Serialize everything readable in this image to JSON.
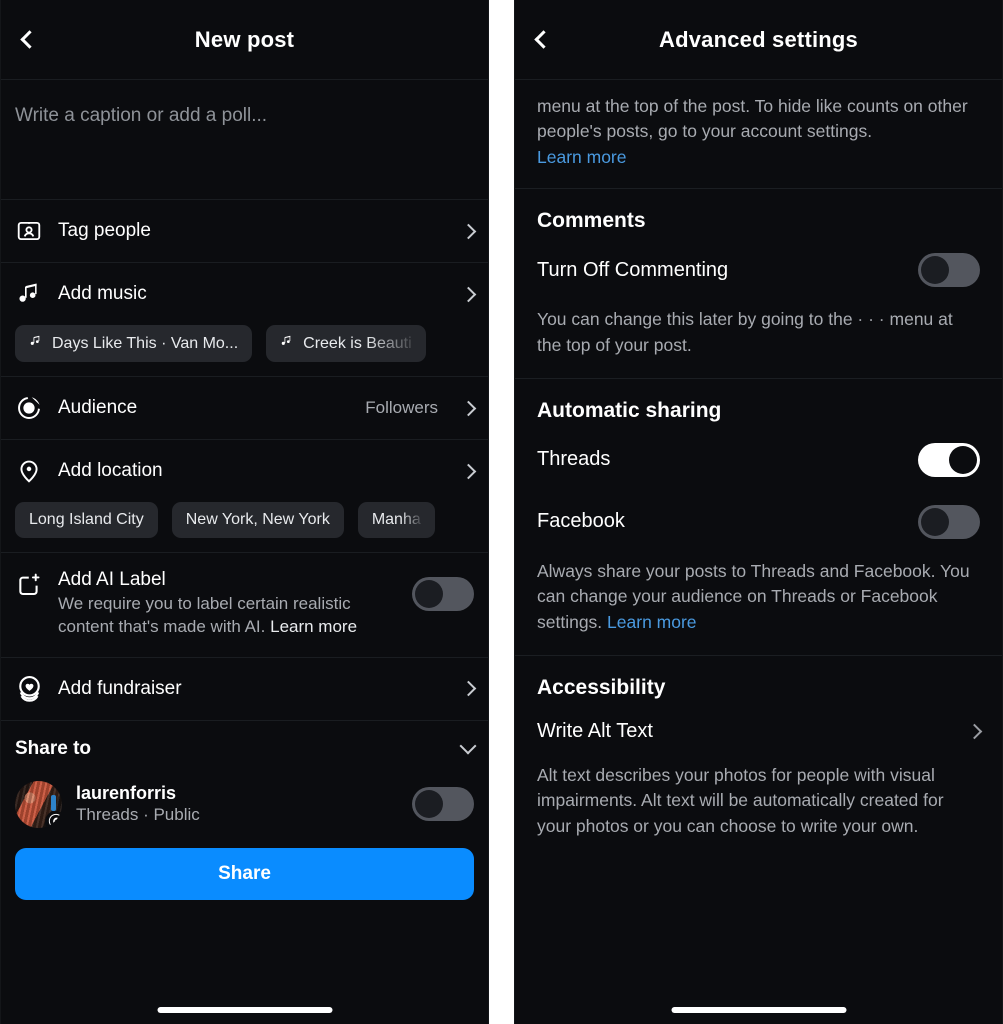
{
  "left_panel": {
    "header": {
      "title": "New post",
      "back_icon": "chevron-left-icon"
    },
    "caption": {
      "placeholder": "Write a caption or add a poll..."
    },
    "rows": {
      "tag_people": {
        "label": "Tag people",
        "icon": "tag-people-icon",
        "chevron": "chevron-right-icon"
      },
      "add_music": {
        "label": "Add music",
        "icon": "music-note-icon",
        "chevron": "chevron-right-icon"
      },
      "audience": {
        "label": "Audience",
        "value": "Followers",
        "icon": "audience-icon",
        "chevron": "chevron-right-icon"
      },
      "add_location": {
        "label": "Add location",
        "icon": "location-pin-icon",
        "chevron": "chevron-right-icon"
      },
      "add_fundraiser": {
        "label": "Add fundraiser",
        "icon": "fundraiser-heart-icon",
        "chevron": "chevron-right-icon"
      }
    },
    "music_suggestions": [
      {
        "label": "Days Like This · Van Mo...",
        "icon": "music-note-icon"
      },
      {
        "label": "Creek is Beauti",
        "icon": "music-note-icon"
      }
    ],
    "location_suggestions": [
      {
        "label": "Long Island City"
      },
      {
        "label": "New York, New York"
      },
      {
        "label": "Manha"
      }
    ],
    "ai_label": {
      "title": "Add AI Label",
      "description": "We require you to label certain realistic content that's made with AI.",
      "learn_more": "Learn more",
      "icon": "ai-sparkle-square-icon",
      "toggle_state": "off"
    },
    "share_to": {
      "heading": "Share to",
      "chevron": "chevron-down-icon",
      "account": {
        "username": "laurenforris",
        "subtitle": "Threads · Public",
        "avatar": "user-avatar",
        "badge": "threads-badge-icon",
        "toggle_state": "off"
      }
    },
    "share_button": {
      "label": "Share",
      "color": "#0a8cff"
    }
  },
  "right_panel": {
    "header": {
      "title": "Advanced settings",
      "back_icon": "chevron-left-icon"
    },
    "intro": {
      "text": "menu at the top of the post. To hide like counts on other people's posts, go to your account settings. ",
      "learn_more": "Learn more"
    },
    "comments": {
      "section_title": "Comments",
      "row_label": "Turn Off Commenting",
      "toggle_state": "off",
      "note_before": "You can change this later by going to the ",
      "note_dots": "· · ·",
      "note_after": " menu at the top of your post."
    },
    "automatic_sharing": {
      "section_title": "Automatic sharing",
      "threads": {
        "label": "Threads",
        "toggle_state": "on"
      },
      "facebook": {
        "label": "Facebook",
        "toggle_state": "off"
      },
      "note": "Always share your posts to Threads and Facebook. You can change your audience on Threads or Facebook settings. ",
      "learn_more": "Learn more"
    },
    "accessibility": {
      "section_title": "Accessibility",
      "row_label": "Write Alt Text",
      "chevron": "chevron-right-icon",
      "note": "Alt text describes your photos for people with visual impairments. Alt text will be automatically created for your photos or you can choose to write your own."
    }
  }
}
